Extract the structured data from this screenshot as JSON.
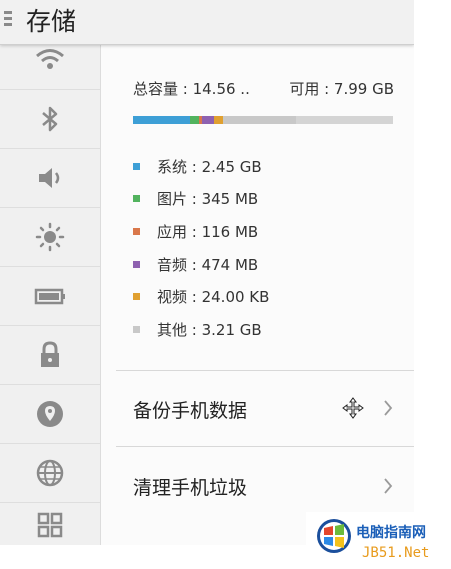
{
  "header": {
    "title": "存储"
  },
  "sidebar": {
    "items": [
      {
        "icon": "wifi-icon",
        "label": "Wi-Fi"
      },
      {
        "icon": "bluetooth-icon",
        "label": "Bluetooth"
      },
      {
        "icon": "volume-icon",
        "label": "Sound"
      },
      {
        "icon": "brightness-icon",
        "label": "Display"
      },
      {
        "icon": "battery-icon",
        "label": "Battery"
      },
      {
        "icon": "lock-icon",
        "label": "Security"
      },
      {
        "icon": "location-icon",
        "label": "Location"
      },
      {
        "icon": "globe-icon",
        "label": "Language"
      },
      {
        "icon": "apps-icon",
        "label": "Apps"
      }
    ]
  },
  "storage": {
    "total": "总容量 : 14.56  ..",
    "available": "可用 : 7.99 GB",
    "categories": [
      {
        "label": "系统 : 2.45 GB",
        "color": "#3d9fd6",
        "share": 0.2195
      },
      {
        "label": "图片 : 345 MB",
        "color": "#52b35e",
        "share": 0.0345
      },
      {
        "label": "应用 : 116 MB",
        "color": "#d9774a",
        "share": 0.0115
      },
      {
        "label": "音频 : 474 MB",
        "color": "#8e61b0",
        "share": 0.0462
      },
      {
        "label": "视频 : 24.00 KB",
        "color": "#e0a030",
        "share": 0.0346
      },
      {
        "label": "其他 : 3.21 GB",
        "color": "#c8c8c8",
        "share": 0.2788
      }
    ]
  },
  "actions": {
    "backup": "备份手机数据",
    "cleanup": "清理手机垃圾"
  },
  "watermark": {
    "title": "电脑指南网",
    "url": "JB51.Net"
  }
}
